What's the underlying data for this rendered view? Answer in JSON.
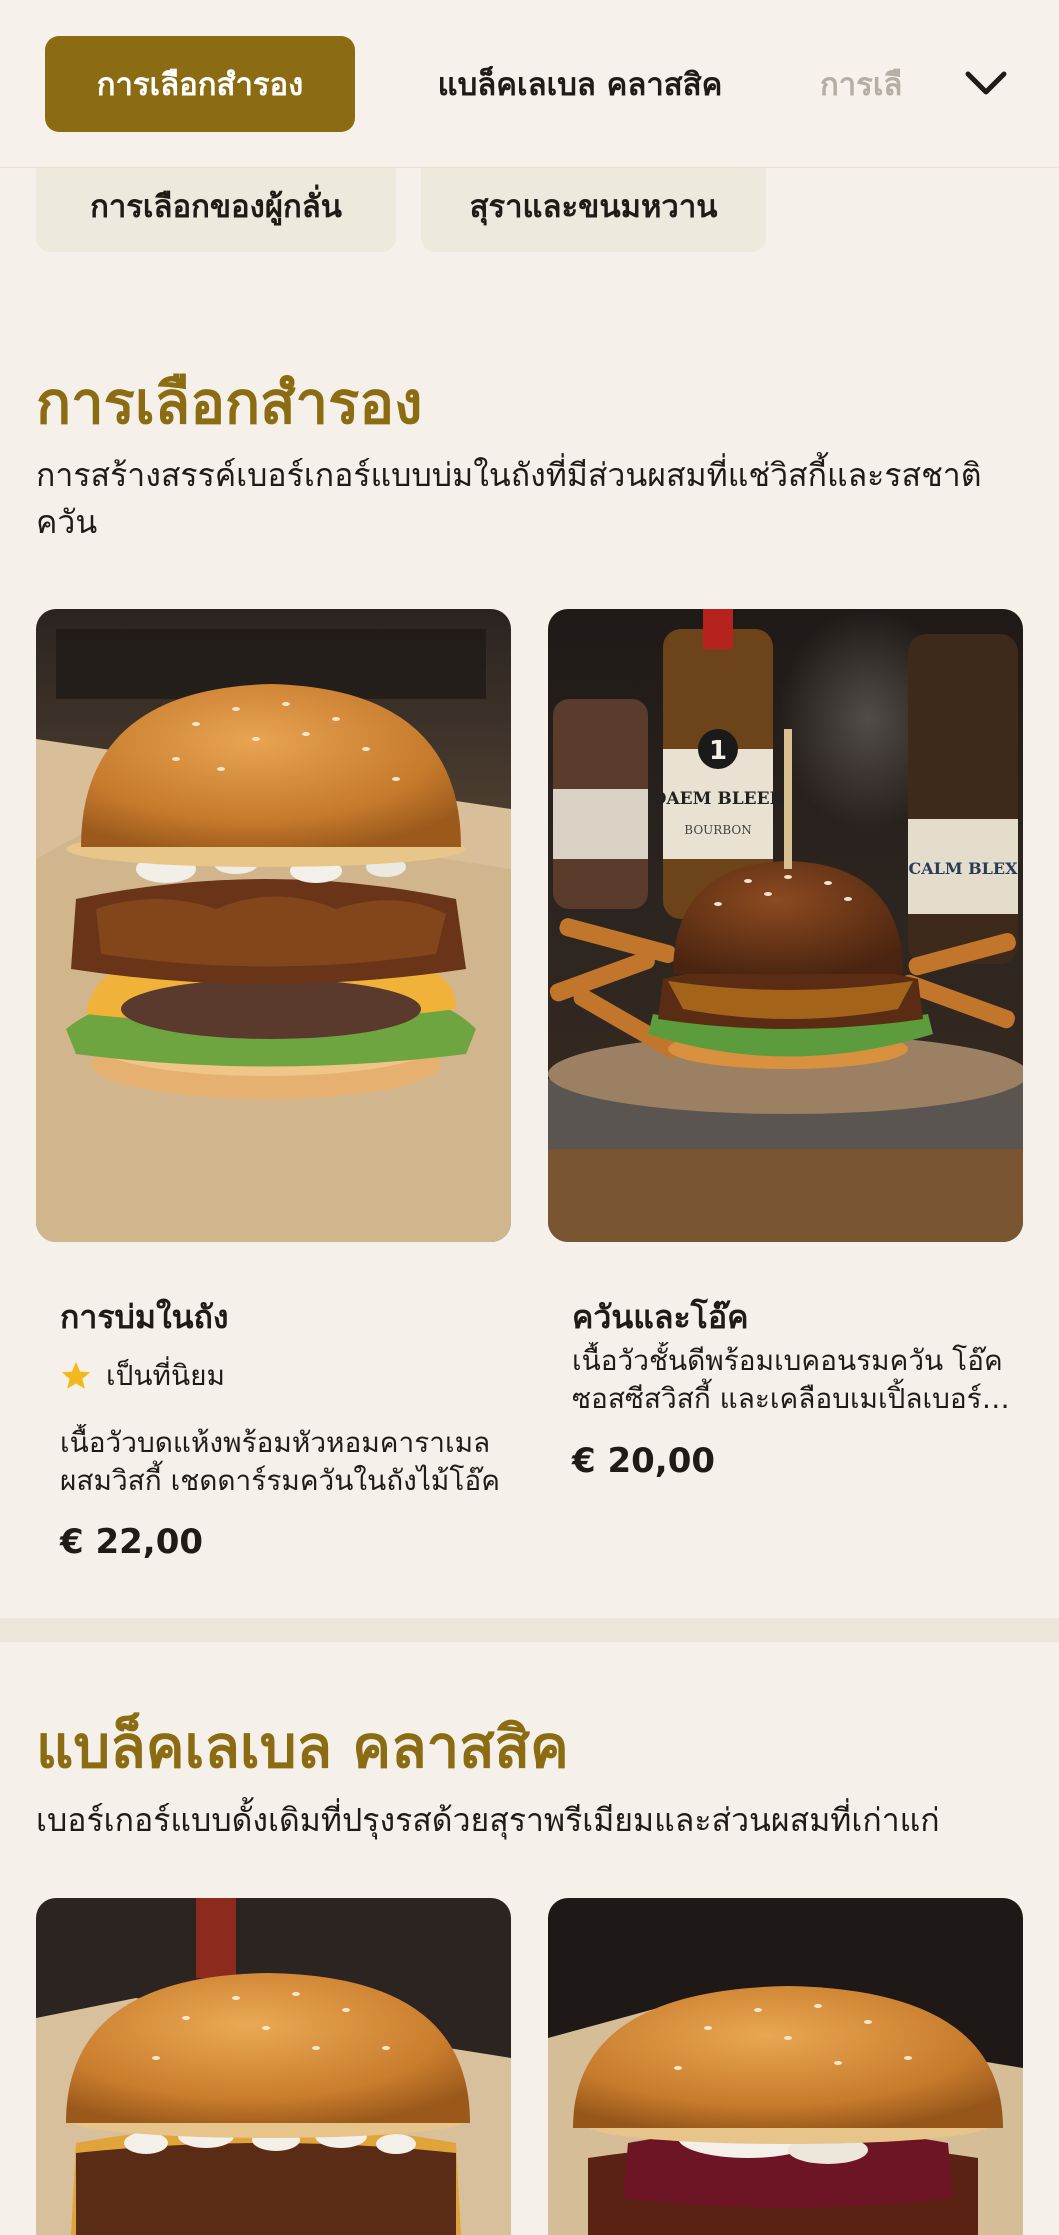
{
  "nav": {
    "tabs": [
      "การเลือกสำรอง",
      "แบล็คเลเบล คลาสสิค",
      "การเลื"
    ],
    "chips": [
      "การเลือกของผู้กลั่น",
      "สุราและขนมหวาน"
    ]
  },
  "sections": [
    {
      "title": "การเลือกสำรอง",
      "description": "การสร้างสรรค์เบอร์เกอร์แบบบ่มในถังที่มีส่วนผสมที่แช่วิสกี้และรสชาติควัน",
      "items": [
        {
          "name": "การบ่มในถัง",
          "badge": "เป็นที่นิยม",
          "description": "เนื้อวัวบดแห้งพร้อมหัวหอมคาราเมลผสมวิสกี้ เชดดาร์รมควันในถังไม้โอ๊ค",
          "price": "€ 22,00"
        },
        {
          "name": "ควันและโอ๊ค",
          "description": "เนื้อวัวชั้นดีพร้อมเบคอนรมควัน โอ๊ค ซอสซีสวิสกี้ และเคลือบเมเปิ้ลเบอร์เบิน",
          "price": "€ 20,00"
        }
      ]
    },
    {
      "title": "แบล็คเลเบล คลาสสิค",
      "description": "เบอร์เกอร์แบบดั้งเดิมที่ปรุงรสด้วยสุราพรีเมียมและส่วนผสมที่เก่าแก่"
    }
  ],
  "bottle_labels": [
    "1",
    "OAEM BLEEK",
    "BOURBON",
    "CALM BLEX"
  ],
  "colors": {
    "accent": "#8b6c12",
    "star": "#f2b81c",
    "background": "#f5f1ea"
  },
  "icons": {
    "chevron": "chevron-down-icon",
    "star": "star-icon"
  }
}
